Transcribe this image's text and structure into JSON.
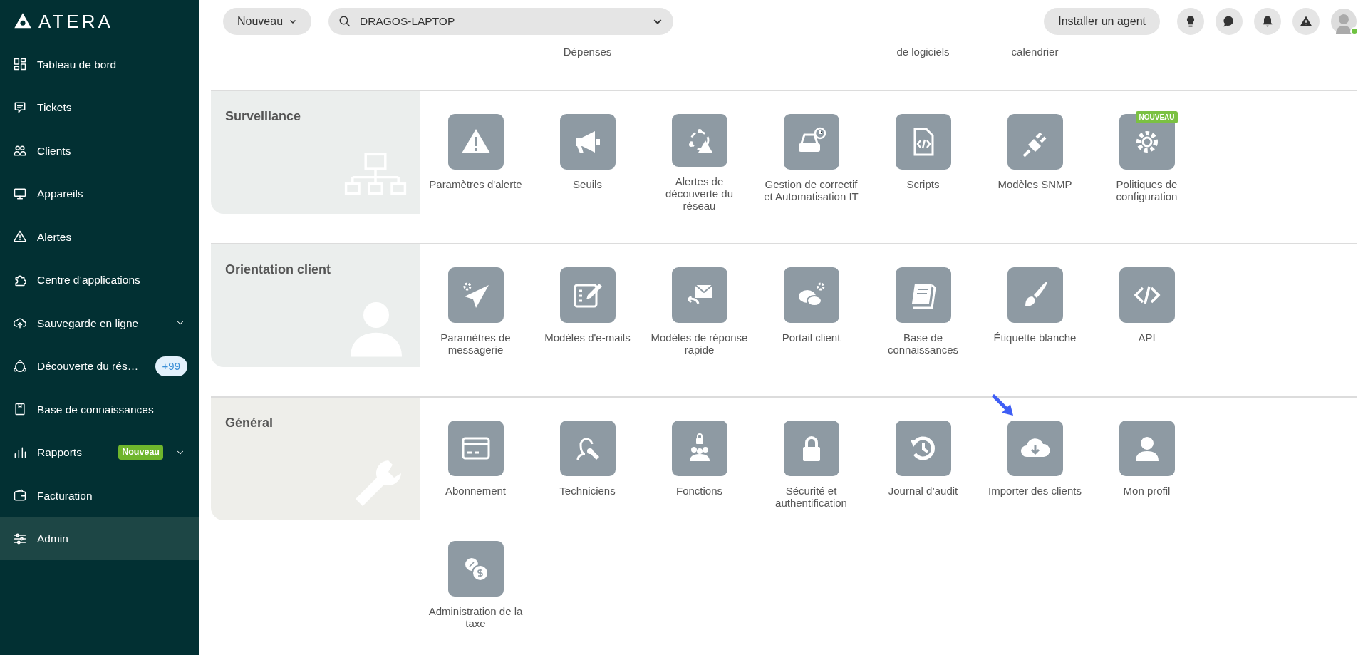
{
  "sidebar": {
    "logo": "ATERA",
    "items": [
      {
        "label": "Tableau de bord",
        "kind": "link",
        "selected": false
      },
      {
        "label": "Tickets",
        "kind": "link",
        "selected": false
      },
      {
        "label": "Clients",
        "kind": "link",
        "selected": false
      },
      {
        "label": "Appareils",
        "kind": "link",
        "selected": false
      },
      {
        "label": "Alertes",
        "kind": "link",
        "selected": false
      },
      {
        "label": "Centre d’applications",
        "kind": "link",
        "selected": false
      },
      {
        "label": "Sauvegarde en ligne",
        "kind": "group",
        "selected": false
      },
      {
        "label": "Découverte du rés…",
        "kind": "link",
        "selected": false,
        "count": "+99"
      },
      {
        "label": "Base de connaissances",
        "kind": "link",
        "selected": false
      },
      {
        "label": "Rapports",
        "kind": "group",
        "selected": false,
        "tag": "Nouveau"
      },
      {
        "label": "Facturation",
        "kind": "link",
        "selected": false
      },
      {
        "label": "Admin",
        "kind": "link",
        "selected": true
      }
    ]
  },
  "header": {
    "new_button": "Nouveau",
    "search": {
      "value": "DRAGOS-LAPTOP"
    },
    "install_button": "Installer un agent",
    "avatar": {
      "online": true
    }
  },
  "partial_row": [
    {
      "label": "Dépenses"
    },
    {
      "label": "de logiciels"
    },
    {
      "label": "calendrier"
    }
  ],
  "sections": [
    {
      "title": "Surveillance",
      "items": [
        {
          "label": "Paramètres d'alerte"
        },
        {
          "label": "Seuils"
        },
        {
          "label": "Alertes de découverte du réseau"
        },
        {
          "label": "Gestion de correctif et Automatisation IT"
        },
        {
          "label": "Scripts"
        },
        {
          "label": "Modèles SNMP"
        },
        {
          "label": "Politiques de configuration",
          "badge": "NOUVEAU"
        }
      ]
    },
    {
      "title": "Orientation client",
      "items": [
        {
          "label": "Paramètres de messagerie"
        },
        {
          "label": "Modèles d'e-mails"
        },
        {
          "label": "Modèles de réponse rapide"
        },
        {
          "label": "Portail client"
        },
        {
          "label": "Base de connaissances"
        },
        {
          "label": "Étiquette blanche"
        },
        {
          "label": "API"
        }
      ]
    },
    {
      "title": "Général",
      "items": [
        {
          "label": "Abonnement"
        },
        {
          "label": "Techniciens"
        },
        {
          "label": "Fonctions"
        },
        {
          "label": "Sécurité et authentification"
        },
        {
          "label": "Journal d’audit"
        },
        {
          "label": "Importer des clients",
          "pointed": true
        },
        {
          "label": "Mon profil"
        },
        {
          "label": "Administration de la taxe"
        }
      ]
    }
  ]
}
